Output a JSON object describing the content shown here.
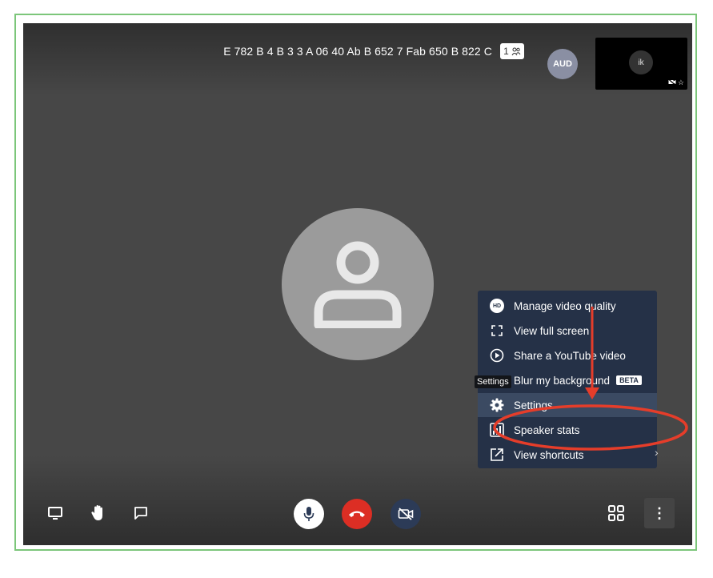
{
  "meeting": {
    "room_name": "E 782 B 4 B 3 3 A 06 40 Ab B 652 7 Fab 650 B 822 C",
    "participant_count": "1",
    "participant_icon": "people-icon",
    "local_initials": "AUD",
    "remote_thumb_initials": "ik"
  },
  "menu": {
    "items": [
      {
        "label": "Manage video quality",
        "icon": "hd-icon"
      },
      {
        "label": "View full screen",
        "icon": "fullscreen-icon"
      },
      {
        "label": "Share a YouTube video",
        "icon": "play-circle-icon"
      },
      {
        "label": "Blur my background",
        "icon": "blur-icon",
        "badge": "BETA"
      },
      {
        "label": "Settings",
        "icon": "gear-icon"
      },
      {
        "label": "Speaker stats",
        "icon": "bar-chart-icon"
      },
      {
        "label": "View shortcuts",
        "icon": "external-link-icon"
      }
    ],
    "hd_badge": "HD",
    "tooltip": "Settings",
    "highlight_color": "#e53d2a"
  },
  "toolbar": {
    "left": [
      "screen-share-icon",
      "raise-hand-icon",
      "chat-icon"
    ],
    "center": [
      "microphone-icon",
      "hangup-icon",
      "camera-off-icon"
    ],
    "right": [
      "tile-view-icon",
      "more-options-icon"
    ],
    "more_label": "⋮"
  },
  "colors": {
    "frame_border": "#7cc67a",
    "hangup": "#dc2e24",
    "menu_bg": "#253147"
  }
}
